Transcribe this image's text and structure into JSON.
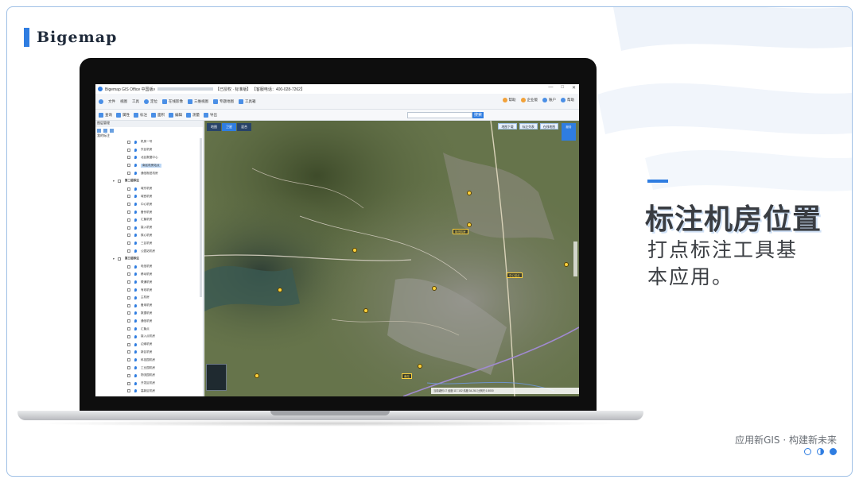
{
  "brand": {
    "name": "Bigemap"
  },
  "app": {
    "title_left": "Bigemap GIS Office 中国版v",
    "title_mid": "【已授权 · 标准版】",
    "title_phone": "【客服电话：400-028-7262】",
    "window_controls": [
      "—",
      "□",
      "✕"
    ],
    "toolbar1": [
      "文件",
      "视图",
      "工具",
      "定位",
      "在线影像",
      "三维视图",
      "专题地图",
      "工具箱"
    ],
    "toolbar1_right": [
      "帮助",
      "企业版",
      "账户",
      "帮助"
    ],
    "toolbar2": [
      "查询",
      "属性",
      "标注",
      "面积",
      "编辑",
      "测量",
      "导出"
    ],
    "search_btn": "搜索",
    "panel_title": "图层管理",
    "panel_root": "我的标注",
    "tree": [
      {
        "type": "item",
        "label": "机房一号"
      },
      {
        "type": "item",
        "label": "东区机房"
      },
      {
        "type": "item",
        "label": "北区数据中心"
      },
      {
        "type": "item",
        "label": "南区机房站点",
        "selected": true
      },
      {
        "type": "item",
        "label": "通信枢纽机房"
      },
      {
        "type": "group",
        "label": "第二组标注"
      },
      {
        "type": "item",
        "label": "城东机房"
      },
      {
        "type": "item",
        "label": "城西机房"
      },
      {
        "type": "item",
        "label": "中心机房"
      },
      {
        "type": "item",
        "label": "备份机房"
      },
      {
        "type": "item",
        "label": "汇聚机房"
      },
      {
        "type": "item",
        "label": "接入机房"
      },
      {
        "type": "item",
        "label": "核心机房"
      },
      {
        "type": "item",
        "label": "三区机房"
      },
      {
        "type": "item",
        "label": "公园站机房"
      },
      {
        "type": "group",
        "label": "第三组标注"
      },
      {
        "type": "item",
        "label": "电信机房"
      },
      {
        "type": "item",
        "label": "移动机房"
      },
      {
        "type": "item",
        "label": "联通机房"
      },
      {
        "type": "item",
        "label": "有线机房"
      },
      {
        "type": "item",
        "label": "主机房"
      },
      {
        "type": "item",
        "label": "备用机房"
      },
      {
        "type": "item",
        "label": "数据机房"
      },
      {
        "type": "item",
        "label": "通信机房"
      },
      {
        "type": "item",
        "label": "汇聚点"
      },
      {
        "type": "item",
        "label": "接入点机房"
      },
      {
        "type": "item",
        "label": "边缘机房"
      },
      {
        "type": "item",
        "label": "新区机房"
      },
      {
        "type": "item",
        "label": "科技园机房"
      },
      {
        "type": "item",
        "label": "工业园机房"
      },
      {
        "type": "item",
        "label": "物流园机房"
      },
      {
        "type": "item",
        "label": "开发区机房"
      },
      {
        "type": "item",
        "label": "高新区机房"
      }
    ],
    "map_tabs": [
      "地图",
      "卫星",
      "混合"
    ],
    "map_actions": [
      "地图下载",
      "标注列表",
      "在线地图"
    ],
    "map_badge": "服务",
    "map_labels": [
      "枢纽机房",
      "中心站点",
      "南站"
    ],
    "map_status": "当前级别:17  经度:117.152  纬度:34.261  比例尺:1:5000"
  },
  "right": {
    "headline": "标注机房位置",
    "sub_line1": "打点标注工具基",
    "sub_line2": "本应用。"
  },
  "footer": {
    "tagline": "应用新GIS · 构建新未来"
  },
  "colors": {
    "accent": "#2f7de1",
    "text": "#3a3d42",
    "frame": "#9fc0e6"
  }
}
